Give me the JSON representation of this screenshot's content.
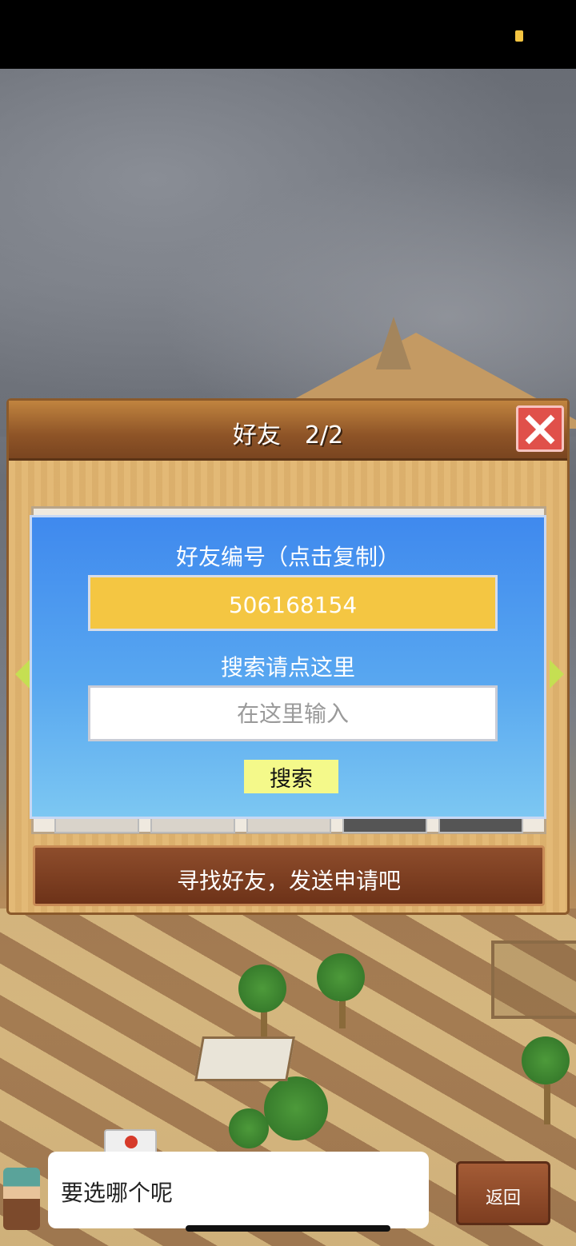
{
  "panel": {
    "title": "好友　2/2",
    "bottom_button_label": "寻找好友，发送申请吧"
  },
  "dialog": {
    "friend_id_label": "好友编号（点击复制）",
    "friend_id_value": "506168154",
    "search_label": "搜索请点这里",
    "search_placeholder": "在这里输入",
    "search_button_label": "搜索"
  },
  "bottom_bar": {
    "chat_text": "要选哪个呢",
    "back_label": "返回"
  },
  "colors": {
    "dialog_bg": "#4a97ef",
    "id_box": "#f4c642",
    "search_button": "#f4f98a",
    "close_button": "#e0504a",
    "bottom_button": "#7a3c20"
  },
  "icons": [
    "close-icon",
    "left-arrow-icon",
    "right-arrow-icon",
    "apple-icon",
    "battery-icon"
  ]
}
